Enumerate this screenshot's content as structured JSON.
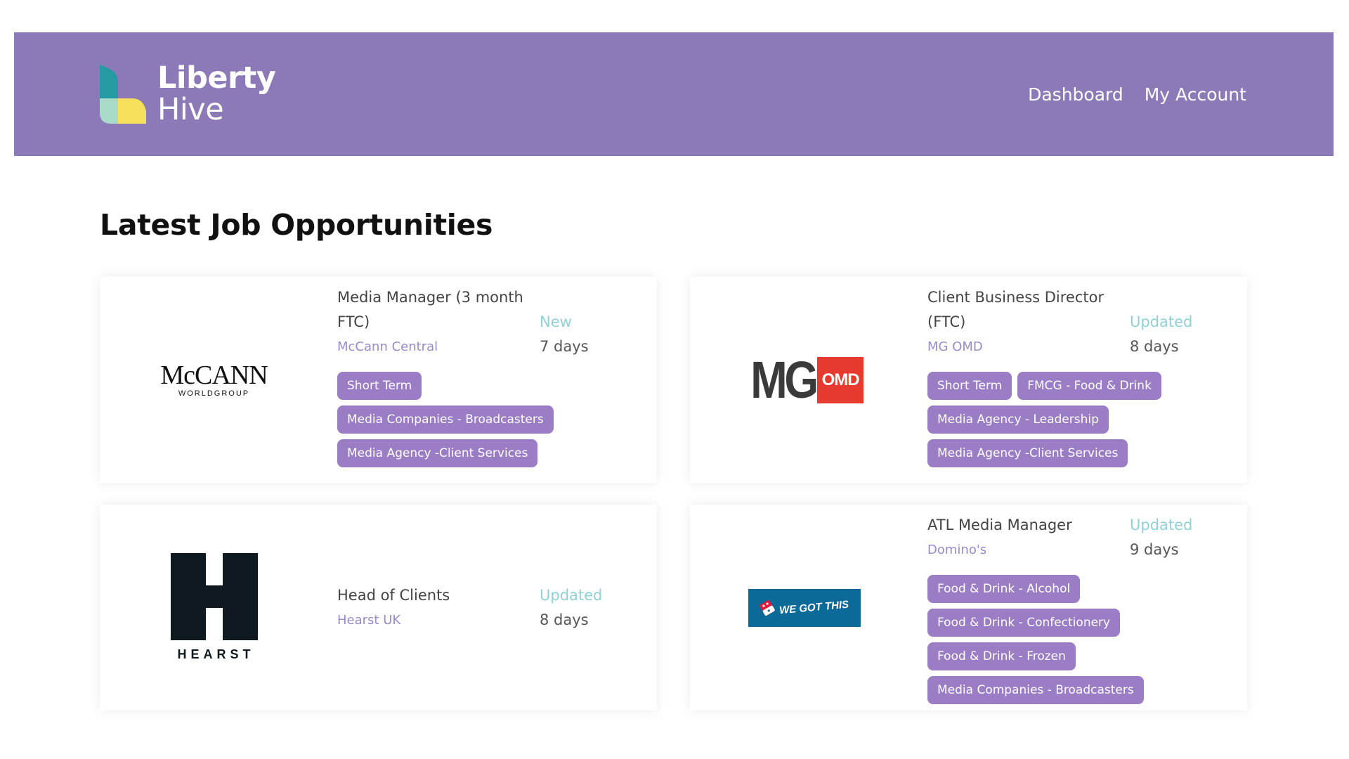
{
  "header": {
    "logo_line1": "Liberty",
    "logo_line2": "Hive",
    "nav": [
      {
        "label": "Dashboard"
      },
      {
        "label": "My Account"
      }
    ]
  },
  "page_title": "Latest Job Opportunities",
  "jobs": [
    {
      "logo": "mccann-worldgroup-logo",
      "logo_text_main": "McCANN",
      "logo_text_sub": "WORLDGROUP",
      "title_line1": "Media Manager (3 month",
      "title_line2": "FTC)",
      "company": "McCann Central",
      "status": "New",
      "age": "7 days",
      "tags": [
        "Short Term",
        "Media Companies - Broadcasters",
        "Media Agency -Client Services"
      ]
    },
    {
      "logo": "mg-omd-logo",
      "logo_text_main": "MG",
      "logo_text_sub": "OMD",
      "title_line1": "Client Business Director",
      "title_line2": "(FTC)",
      "company": "MG OMD",
      "status": "Updated",
      "age": "8 days",
      "tags": [
        "Short Term",
        "FMCG - Food & Drink",
        "Media Agency - Leadership",
        "Media Agency -Client Services"
      ]
    },
    {
      "logo": "hearst-logo",
      "logo_text_main": "H",
      "logo_text_sub": "HEARST",
      "title_line1": "Head of Clients",
      "company": "Hearst UK",
      "status": "Updated",
      "age": "8 days",
      "tags": []
    },
    {
      "logo": "dominos-logo",
      "logo_text_main": "WE GOT THIS",
      "title_line1": "ATL Media Manager",
      "company": "Domino's",
      "status": "Updated",
      "age": "9 days",
      "tags": [
        "Food & Drink - Alcohol",
        "Food & Drink - Confectionery",
        "Food & Drink - Frozen",
        "Media Companies - Broadcasters"
      ]
    }
  ],
  "colors": {
    "header_bg": "#8c7ab8",
    "tag_bg": "#9a7dc4",
    "status": "#8fd1d5",
    "company": "#9a8cc8"
  }
}
